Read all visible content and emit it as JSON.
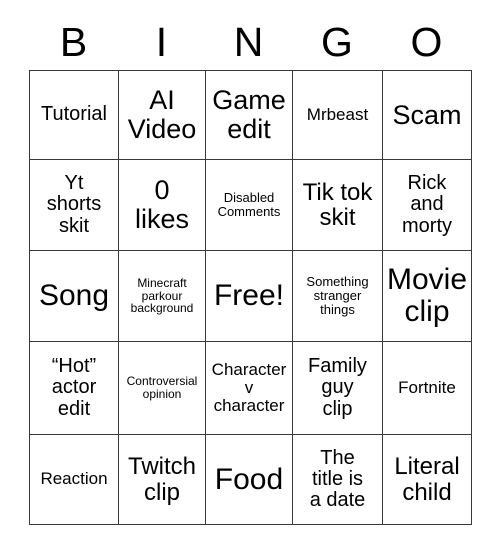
{
  "card": {
    "header": {
      "letters": [
        "B",
        "I",
        "N",
        "G",
        "O"
      ]
    },
    "columns": 5,
    "rows": 5,
    "colors": {
      "background": "#ffffff",
      "grid_line": "#3a3a3a",
      "text": "#000000"
    },
    "cells": [
      [
        {
          "text": "Tutorial",
          "size": "md"
        },
        {
          "text": "AI\nVideo",
          "size": "xl"
        },
        {
          "text": "Game\nedit",
          "size": "xl"
        },
        {
          "text": "Mrbeast",
          "size": "sm"
        },
        {
          "text": "Scam",
          "size": "xl"
        }
      ],
      [
        {
          "text": "Yt\nshorts\nskit",
          "size": "md"
        },
        {
          "text": "0\nlikes",
          "size": "xl"
        },
        {
          "text": "Disabled\nComments",
          "size": "xs"
        },
        {
          "text": "Tik tok\nskit",
          "size": "lg"
        },
        {
          "text": "Rick\nand\nmorty",
          "size": "md"
        }
      ],
      [
        {
          "text": "Song",
          "size": "xxl"
        },
        {
          "text": "Minecraft\nparkour\nbackground",
          "size": "xxs"
        },
        {
          "text": "Free!",
          "size": "xxl"
        },
        {
          "text": "Something\nstranger\nthings",
          "size": "xs"
        },
        {
          "text": "Movie\nclip",
          "size": "xxl"
        }
      ],
      [
        {
          "text": "“Hot”\nactor\nedit",
          "size": "md"
        },
        {
          "text": "Controversial\nopinion",
          "size": "xxs"
        },
        {
          "text": "Character\nv\ncharacter",
          "size": "sm"
        },
        {
          "text": "Family\nguy\nclip",
          "size": "md"
        },
        {
          "text": "Fortnite",
          "size": "sm"
        }
      ],
      [
        {
          "text": "Reaction",
          "size": "sm"
        },
        {
          "text": "Twitch\nclip",
          "size": "lg"
        },
        {
          "text": "Food",
          "size": "xxl"
        },
        {
          "text": "The\ntitle is\na date",
          "size": "md"
        },
        {
          "text": "Literal\nchild",
          "size": "lg"
        }
      ]
    ]
  }
}
